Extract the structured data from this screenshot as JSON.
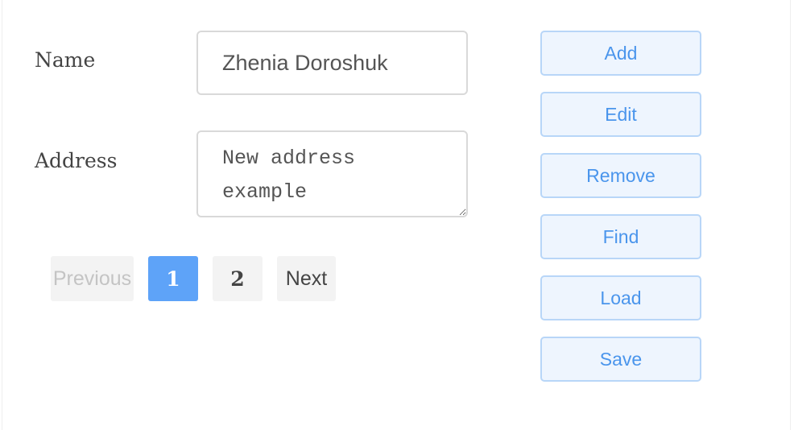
{
  "form": {
    "name_label": "Name",
    "name_value": "Zhenia Doroshuk",
    "address_label": "Address",
    "address_value": "New address\nexample"
  },
  "pagination": {
    "previous_label": "Previous",
    "pages": [
      "1",
      "2"
    ],
    "current_page": "1",
    "next_label": "Next"
  },
  "actions": {
    "add_label": "Add",
    "edit_label": "Edit",
    "remove_label": "Remove",
    "find_label": "Find",
    "load_label": "Load",
    "save_label": "Save"
  },
  "colors": {
    "accent": "#5ea3f8",
    "action_text": "#4a95ec",
    "action_bg": "#eef5fe",
    "action_border": "#b8d6f8"
  }
}
